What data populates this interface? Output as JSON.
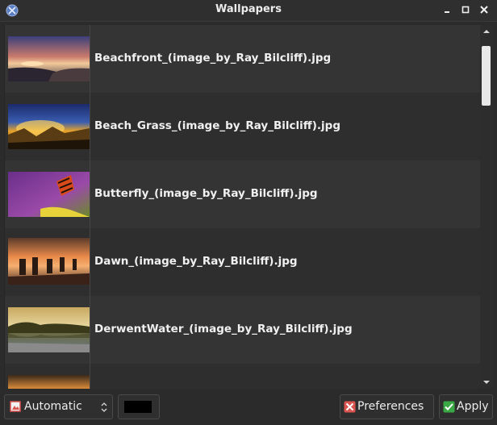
{
  "window": {
    "title": "Wallpapers"
  },
  "wallpapers": [
    {
      "filename": "Beachfront_(image_by_Ray_Bilcliff).jpg",
      "thumbnail": "sunset-beach-rocks"
    },
    {
      "filename": "Beach_Grass_(image_by_Ray_Bilcliff).jpg",
      "thumbnail": "golden-grass-blue-sky"
    },
    {
      "filename": "Butterfly_(image_by_Ray_Bilcliff).jpg",
      "thumbnail": "butterfly-on-purple"
    },
    {
      "filename": "Dawn_(image_by_Ray_Bilcliff).jpg",
      "thumbnail": "pier-posts-sunrise"
    },
    {
      "filename": "DerwentWater_(image_by_Ray_Bilcliff).jpg",
      "thumbnail": "lake-reflection"
    },
    {
      "filename": "",
      "thumbnail": "partial-dark-landscape"
    }
  ],
  "bottom_bar": {
    "mode_select": {
      "value": "Automatic",
      "icon": "image-mode-icon"
    },
    "background_color": "#000000",
    "preferences_label": "Preferences",
    "apply_label": "Apply"
  },
  "colors": {
    "accent_red": "#d9534f",
    "apply_green": "#3aa845"
  }
}
